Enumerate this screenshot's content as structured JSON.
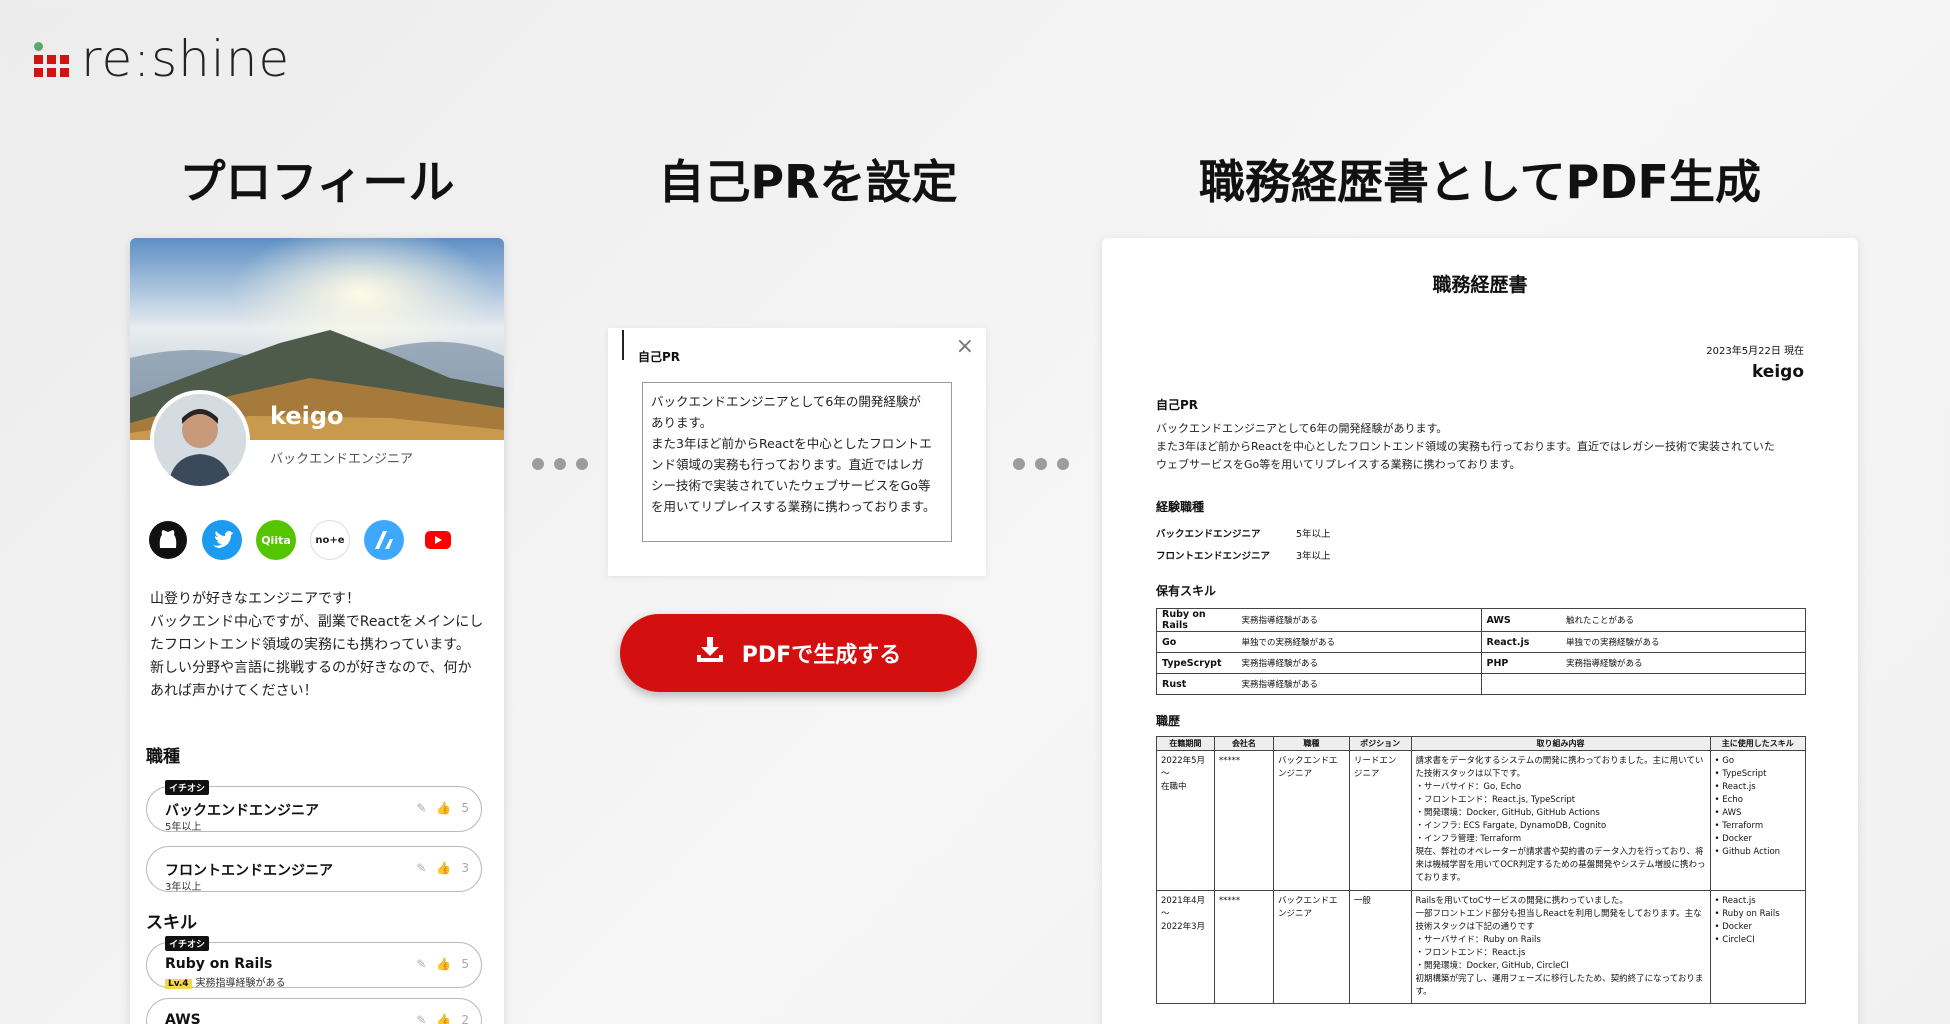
{
  "logo": {
    "text": "re:shine"
  },
  "headings": {
    "profile": "プロフィール",
    "pr": "自己PRを設定",
    "pdf": "職務経歴書としてPDF生成"
  },
  "profile": {
    "name": "keigo",
    "role": "バックエンドエンジニア",
    "socials": [
      {
        "name": "github",
        "label": ""
      },
      {
        "name": "twitter",
        "label": ""
      },
      {
        "name": "qiita",
        "label": "Qiita"
      },
      {
        "name": "note",
        "label": "no+e"
      },
      {
        "name": "zenn",
        "label": ""
      },
      {
        "name": "youtube",
        "label": ""
      }
    ],
    "bio": [
      "山登りが好きなエンジニアです！",
      "バックエンド中心ですが、副業でReactをメインにし",
      "たフロントエンド領域の実務にも携わっています。",
      "新しい分野や言語に挑戦するのが好きなので、何か",
      "あれば声かけてください！"
    ],
    "jobs_title": "職種",
    "jobs": [
      {
        "badge": "イチオシ",
        "name": "バックエンドエンジニア",
        "sub": "5年以上",
        "likes": "5"
      },
      {
        "badge": "",
        "name": "フロントエンドエンジニア",
        "sub": "3年以上",
        "likes": "3"
      }
    ],
    "skills_title": "スキル",
    "skills": [
      {
        "badge": "イチオシ",
        "name": "Ruby on Rails",
        "level": "Lv.4",
        "sub": "実務指導経験がある",
        "likes": "5"
      },
      {
        "badge": "",
        "name": "AWS",
        "level": "",
        "sub": "",
        "likes": "2"
      }
    ]
  },
  "pr_editor": {
    "label": "自己PR",
    "close": "×",
    "lines": [
      "バックエンドエンジニアとして6年の開発経験が",
      "あります。",
      "また3年ほど前からReactを中心としたフロントエ",
      "ンド領域の実務も行っております。直近ではレガ",
      "シー技術で実装されていたウェブサービスをGo等",
      "を用いてリプレイスする業務に携わっております。"
    ]
  },
  "pdf_button": {
    "label": "PDFで生成する"
  },
  "resume": {
    "title": "職務経歴書",
    "date": "2023年5月22日 現在",
    "user": "keigo",
    "pr_title": "自己PR",
    "pr_lines": [
      "バックエンドエンジニアとして6年の開発経験があります。",
      "また3年ほど前からReactを中心としたフロントエンド領域の実務も行っております。直近ではレガシー技術で実装されていた",
      "ウェブサービスをGo等を用いてリプレイスする業務に携わっております。"
    ],
    "exp_title": "経験職種",
    "experience": [
      {
        "job": "バックエンドエンジニア",
        "years": "5年以上"
      },
      {
        "job": "フロントエンドエンジニア",
        "years": "3年以上"
      }
    ],
    "skills_title": "保有スキル",
    "skills": [
      [
        {
          "name": "Ruby on Rails",
          "value": "実務指導経験がある"
        },
        {
          "name": "AWS",
          "value": "触れたことがある"
        }
      ],
      [
        {
          "name": "Go",
          "value": "単独での実務経験がある"
        },
        {
          "name": "React.js",
          "value": "単独での実務経験がある"
        }
      ],
      [
        {
          "name": "TypeScrypt",
          "value": "実務指導経験がある"
        },
        {
          "name": "PHP",
          "value": "実務指導経験がある"
        }
      ],
      [
        {
          "name": "Rust",
          "value": "実務指導経験がある"
        },
        {
          "name": "",
          "value": ""
        }
      ]
    ],
    "history_title": "職歴",
    "history_headers": [
      "在籍期間",
      "会社名",
      "職種",
      "ポジション",
      "取り組み内容",
      "主に使用したスキル"
    ],
    "history": [
      {
        "period": [
          "2022年5月",
          "〜",
          "在職中"
        ],
        "company": "*****",
        "job": [
          "バックエンドエ",
          "ンジニア"
        ],
        "position": [
          "リードエン",
          "ジニア"
        ],
        "content": [
          "請求書をデータ化するシステムの開発に携わっておりました。主に用いてい",
          "た技術スタックは以下です。",
          "・サーバサイド：Go, Echo",
          "・フロントエンド：React.js, TypeScript",
          "・開発環境：Docker, GitHub, GitHub Actions",
          "・インフラ: ECS Fargate, DynamoDB, Cognito",
          "・インフラ管理: Terraform",
          "現在、弊社のオペレーターが請求書や契約書のデータ入力を行っており、将",
          "来は機械学習を用いてOCR判定するための基盤開発やシステム増設に携わっ",
          "ております。"
        ],
        "skills": [
          "• Go",
          "• TypeScript",
          "• React.js",
          "• Echo",
          "• AWS",
          "• Terraform",
          "• Docker",
          "• Github Action"
        ]
      },
      {
        "period": [
          "2021年4月",
          "〜",
          "2022年3月"
        ],
        "company": "*****",
        "job": [
          "バックエンドエ",
          "ンジニア"
        ],
        "position": [
          "一般"
        ],
        "content": [
          "Railsを用いてtoCサービスの開発に携わっていました。",
          "一部フロントエンド部分も担当しReactを利用し開発をしております。主な",
          "技術スタックは下記の通りです",
          "・サーバサイド：Ruby on Rails",
          "・フロントエンド：React.js",
          "・開発環境：Docker, GitHub, CircleCI",
          "初期構築が完了し、運用フェーズに移行したため、契約終了になっておりま",
          "す。"
        ],
        "skills": [
          "• React.js",
          "• Ruby on Rails",
          "• Docker",
          "• CircleCI"
        ]
      }
    ]
  }
}
